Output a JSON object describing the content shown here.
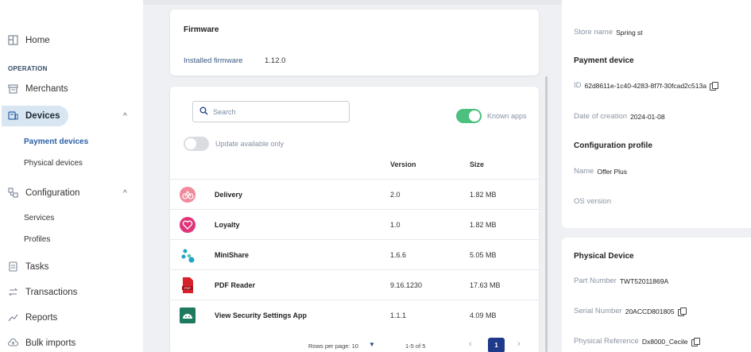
{
  "sidebar": {
    "home": "Home",
    "section": "OPERATION",
    "merchants": "Merchants",
    "devices": "Devices",
    "devices_sub": [
      "Payment devices",
      "Physical devices"
    ],
    "configuration": "Configuration",
    "configuration_sub": [
      "Services",
      "Profiles"
    ],
    "tasks": "Tasks",
    "transactions": "Transactions",
    "reports": "Reports",
    "bulk_imports": "Bulk imports",
    "active_color": "#d8e6f2"
  },
  "firmware": {
    "title": "Firmware",
    "label": "Installed firmware",
    "value": "1.12.0"
  },
  "apps": {
    "search_placeholder": "Search",
    "known_apps_label": "Known apps",
    "known_apps_on": true,
    "update_only_label": "Update available only",
    "update_only_on": false,
    "col_version": "Version",
    "col_size": "Size",
    "rows": [
      {
        "name": "Delivery",
        "version": "2.0",
        "size": "1.82 MB",
        "icon": "delivery-icon",
        "color": "#f08a9c"
      },
      {
        "name": "Loyalty",
        "version": "1.0",
        "size": "1.82 MB",
        "icon": "loyalty-icon",
        "color": "#e0357a"
      },
      {
        "name": "MiniShare",
        "version": "1.6.6",
        "size": "5.05 MB",
        "icon": "minishare-icon",
        "color": "#1fa3c8"
      },
      {
        "name": "PDF Reader",
        "version": "9.16.1230",
        "size": "17.63 MB",
        "icon": "pdf-icon",
        "color": "#d8202a"
      },
      {
        "name": "View Security Settings App",
        "version": "1.1.1",
        "size": "4.09 MB",
        "icon": "android-icon",
        "color": "#1e7a5f"
      }
    ],
    "pager": {
      "rows_per_page": "Rows per page: 10",
      "range": "1-5 of 5",
      "page": "1"
    }
  },
  "details": {
    "store_label": "Store name",
    "store_value": "Spring st",
    "payment_device_title": "Payment device",
    "id_label": "ID",
    "id_value": "62d8611e-1c40-4283-8f7f-30fcad2c513a",
    "created_label": "Date of creation",
    "created_value": "2024-01-08",
    "config_title": "Configuration profile",
    "name_label": "Name",
    "name_value": "Offer Plus",
    "os_label": "OS version",
    "physical_title": "Physical Device",
    "part_label": "Part Number",
    "part_value": "TWT52011869A",
    "serial_label": "Serial Number",
    "serial_value": "20ACCD801805",
    "ref_label": "Physical Reference",
    "ref_value": "Dx8000_Cecile"
  }
}
